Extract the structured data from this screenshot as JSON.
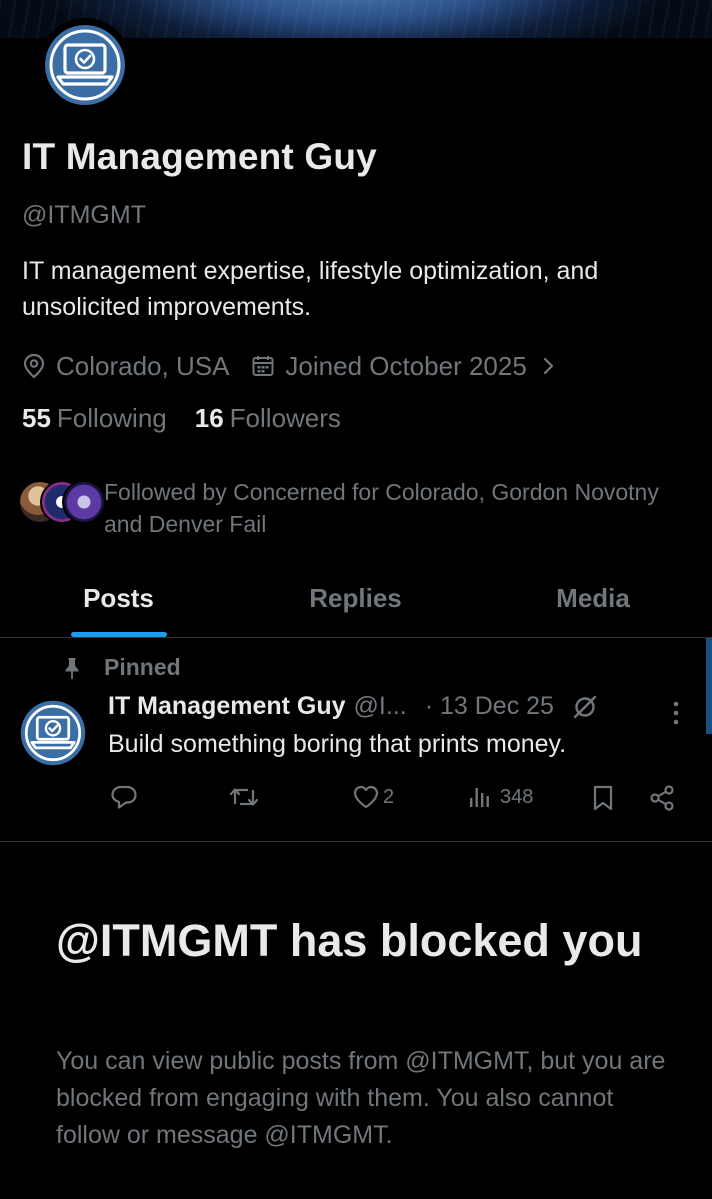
{
  "profile": {
    "display_name": "IT Management Guy",
    "handle": "@ITMGMT",
    "bio": "IT management expertise, lifestyle optimization, and unsolicited improvements.",
    "location": "Colorado, USA",
    "joined": "Joined October 2025",
    "following_count": "55",
    "following_label": "Following",
    "followers_count": "16",
    "followers_label": "Followers",
    "followed_by": "Followed by Concerned for Colorado, Gordon Novotny and Denver Fail"
  },
  "tabs": [
    {
      "label": "Posts",
      "active": true
    },
    {
      "label": "Replies",
      "active": false
    },
    {
      "label": "Media",
      "active": false
    }
  ],
  "pinned_post": {
    "pinned_label": "Pinned",
    "author_name": "IT Management Guy",
    "author_handle": "@I...",
    "date": "· 13 Dec 25",
    "text": "Build something boring that prints money.",
    "likes": "2",
    "views": "348"
  },
  "blocked": {
    "title": "@ITMGMT has blocked you",
    "body": "You can view public posts from @ITMGMT, but you are blocked from engaging with them. You also cannot follow or message @ITMGMT."
  },
  "colors": {
    "accent": "#1d9bf0",
    "muted": "#71767b",
    "text": "#e7e9ea",
    "background": "#000000",
    "avatar_blue": "#3a6ea5"
  },
  "icons": [
    "location-pin-icon",
    "calendar-icon",
    "chevron-right-icon",
    "pin-icon",
    "grok-icon",
    "more-icon",
    "reply-icon",
    "repost-icon",
    "like-icon",
    "views-icon",
    "bookmark-icon",
    "share-icon",
    "laptop-check-icon"
  ]
}
